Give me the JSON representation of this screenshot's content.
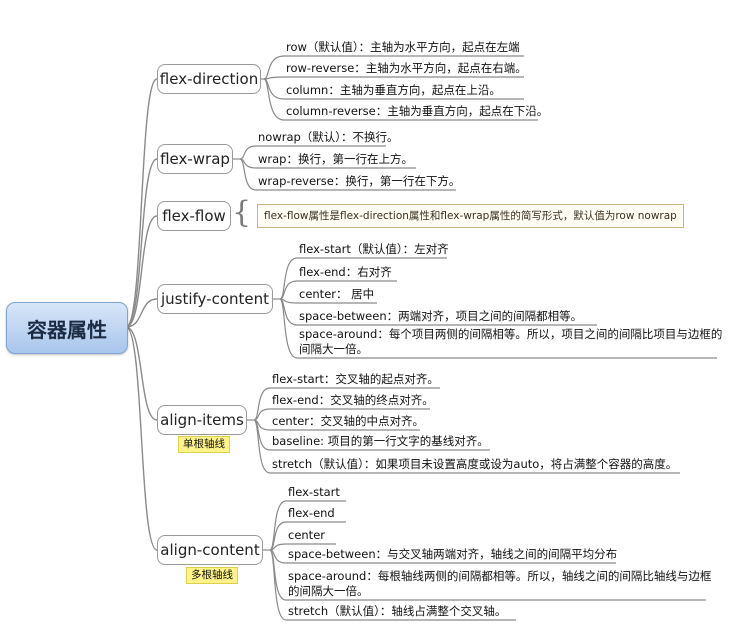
{
  "root": {
    "label": "容器属性"
  },
  "branches": [
    {
      "label": "flex-direction",
      "items": [
        "row（默认值）：主轴为水平方向，起点在左端",
        "row-reverse：主轴为水平方向，起点在右端。",
        "column：主轴为垂直方向，起点在上沿。",
        "column-reverse：主轴为垂直方向，起点在下沿。"
      ]
    },
    {
      "label": "flex-wrap",
      "items": [
        "nowrap（默认）：不换行。",
        "wrap：换行，第一行在上方。",
        "wrap-reverse：换行，第一行在下方。"
      ]
    },
    {
      "label": "flex-flow",
      "note": "flex-flow属性是flex-direction属性和flex-wrap属性的简写形式，默认值为row nowrap"
    },
    {
      "label": "justify-content",
      "items": [
        "flex-start（默认值）：左对齐",
        "flex-end：右对齐",
        "center： 居中",
        "space-between：两端对齐，项目之间的间隔都相等。",
        "space-around：每个项目两侧的间隔相等。所以，项目之间的间隔比项目与边框的间隔大一倍。"
      ]
    },
    {
      "label": "align-items",
      "tag": "单根轴线",
      "items": [
        "flex-start：交叉轴的起点对齐。",
        "flex-end：交叉轴的终点对齐。",
        "center：交叉轴的中点对齐。",
        "baseline: 项目的第一行文字的基线对齐。",
        "stretch（默认值）：如果项目未设置高度或设为auto，将占满整个容器的高度。"
      ]
    },
    {
      "label": "align-content",
      "tag": "多根轴线",
      "items": [
        "flex-start",
        "flex-end",
        "center",
        "space-between：与交叉轴两端对齐，轴线之间的间隔平均分布",
        "space-around：每根轴线两侧的间隔都相等。所以，轴线之间的间隔比轴线与边框的间隔大一倍。",
        "stretch（默认值）：轴线占满整个交叉轴。"
      ]
    }
  ],
  "colors": {
    "line": "#8a8a8a",
    "root_fill": "#b9d1f0",
    "tag_fill": "#fff38a"
  }
}
